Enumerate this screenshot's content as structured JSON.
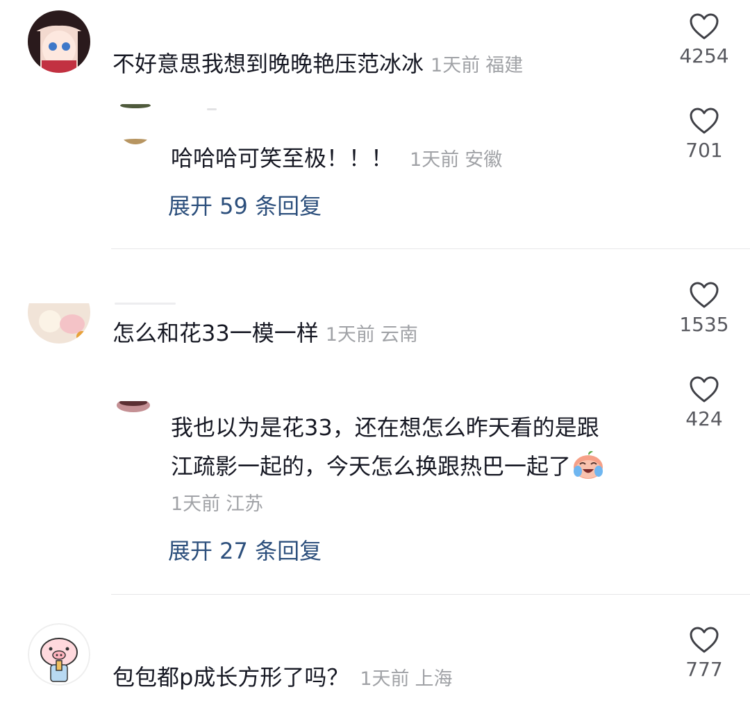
{
  "comments": [
    {
      "text": "不好意思我想到晚晚艳压范冰冰",
      "time": "1天前",
      "location": "福建",
      "likes": "4254",
      "reply": {
        "text": "哈哈哈可笑至极！！！",
        "time": "1天前",
        "location": "安徽",
        "likes": "701",
        "expand_label": "展开 59 条回复"
      }
    },
    {
      "text": "怎么和花33一模一样",
      "time": "1天前",
      "location": "云南",
      "likes": "1535",
      "reply": {
        "text_line1": "我也以为是花33，还在想怎么昨天看的是跟",
        "text_line2": "江疏影一起的，今天怎么换跟热巴一起了",
        "time": "1天前",
        "location": "江苏",
        "likes": "424",
        "expand_label": "展开 27 条回复"
      }
    },
    {
      "text": "包包都p成长方形了吗？",
      "time": "1天前",
      "location": "上海",
      "likes": "777"
    }
  ],
  "icons": {
    "like": "heart-outline-icon",
    "emoji": "crying-laughing-peach-emoji"
  },
  "colors": {
    "text": "#161823",
    "meta": "#a0a2a6",
    "expand_link": "#2c4f7c",
    "like_count": "#57585e"
  }
}
